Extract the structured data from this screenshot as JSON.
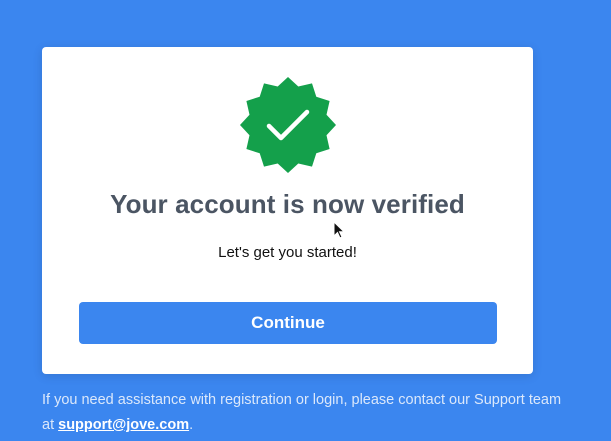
{
  "card": {
    "badge_icon": "verified-badge-check-icon",
    "title": "Your account is now verified",
    "subtitle": "Let's get you started!",
    "continue_label": "Continue"
  },
  "footer": {
    "text_before": "If you need assistance with registration or login, please contact our Support team at ",
    "support_email": "support@jove.com",
    "text_after": "."
  },
  "colors": {
    "background": "#3b86ef",
    "button": "#3b86ef",
    "badge": "#14a04b",
    "title": "#4b5563"
  }
}
